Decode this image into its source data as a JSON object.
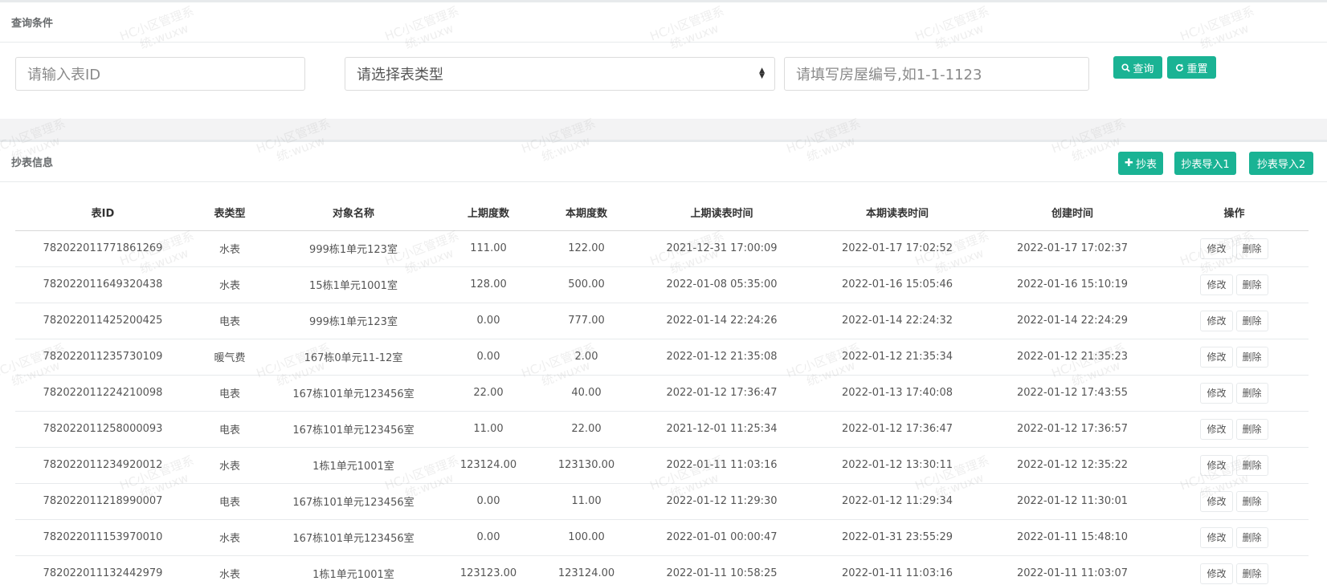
{
  "query": {
    "title": "查询条件",
    "meter_id_placeholder": "请输入表ID",
    "meter_type_placeholder": "请选择表类型",
    "room_placeholder": "请填写房屋编号,如1-1-1123",
    "search_label": "查询",
    "reset_label": "重置"
  },
  "list": {
    "title": "抄表信息",
    "add_label": "抄表",
    "import1_label": "抄表导入1",
    "import2_label": "抄表导入2",
    "columns": [
      "表ID",
      "表类型",
      "对象名称",
      "上期度数",
      "本期度数",
      "上期读表时间",
      "本期读表时间",
      "创建时间",
      "操作"
    ],
    "edit_label": "修改",
    "delete_label": "删除",
    "rows": [
      {
        "id": "782022011771861269",
        "type": "水表",
        "name": "999栋1单元123室",
        "prev": "111.00",
        "cur": "122.00",
        "prev_time": "2021-12-31 17:00:09",
        "cur_time": "2022-01-17 17:02:52",
        "created": "2022-01-17 17:02:37"
      },
      {
        "id": "782022011649320438",
        "type": "水表",
        "name": "15栋1单元1001室",
        "prev": "128.00",
        "cur": "500.00",
        "prev_time": "2022-01-08 05:35:00",
        "cur_time": "2022-01-16 15:05:46",
        "created": "2022-01-16 15:10:19"
      },
      {
        "id": "782022011425200425",
        "type": "电表",
        "name": "999栋1单元123室",
        "prev": "0.00",
        "cur": "777.00",
        "prev_time": "2022-01-14 22:24:26",
        "cur_time": "2022-01-14 22:24:32",
        "created": "2022-01-14 22:24:29"
      },
      {
        "id": "782022011235730109",
        "type": "暖气费",
        "name": "167栋0单元11-12室",
        "prev": "0.00",
        "cur": "2.00",
        "prev_time": "2022-01-12 21:35:08",
        "cur_time": "2022-01-12 21:35:34",
        "created": "2022-01-12 21:35:23"
      },
      {
        "id": "782022011224210098",
        "type": "电表",
        "name": "167栋101单元123456室",
        "prev": "22.00",
        "cur": "40.00",
        "prev_time": "2022-01-12 17:36:47",
        "cur_time": "2022-01-13 17:40:08",
        "created": "2022-01-12 17:43:55"
      },
      {
        "id": "782022011258000093",
        "type": "电表",
        "name": "167栋101单元123456室",
        "prev": "11.00",
        "cur": "22.00",
        "prev_time": "2021-12-01 11:25:34",
        "cur_time": "2022-01-12 17:36:47",
        "created": "2022-01-12 17:36:57"
      },
      {
        "id": "782022011234920012",
        "type": "水表",
        "name": "1栋1单元1001室",
        "prev": "123124.00",
        "cur": "123130.00",
        "prev_time": "2022-01-11 11:03:16",
        "cur_time": "2022-01-12 13:30:11",
        "created": "2022-01-12 12:35:22"
      },
      {
        "id": "782022011218990007",
        "type": "电表",
        "name": "167栋101单元123456室",
        "prev": "0.00",
        "cur": "11.00",
        "prev_time": "2022-01-12 11:29:30",
        "cur_time": "2022-01-12 11:29:34",
        "created": "2022-01-12 11:30:01"
      },
      {
        "id": "782022011153970010",
        "type": "水表",
        "name": "167栋101单元123456室",
        "prev": "0.00",
        "cur": "100.00",
        "prev_time": "2022-01-01 00:00:47",
        "cur_time": "2022-01-31 23:55:29",
        "created": "2022-01-11 15:48:10"
      },
      {
        "id": "782022011132442979",
        "type": "水表",
        "name": "1栋1单元1001室",
        "prev": "123123.00",
        "cur": "123124.00",
        "prev_time": "2022-01-11 10:58:25",
        "cur_time": "2022-01-11 11:03:16",
        "created": "2022-01-11 11:03:07"
      }
    ]
  },
  "watermark": {
    "line1": "HC小区管理系",
    "line2": "统:wuxw"
  },
  "colors": {
    "primary": "#1ab394",
    "page_bg": "#f3f3f4"
  }
}
